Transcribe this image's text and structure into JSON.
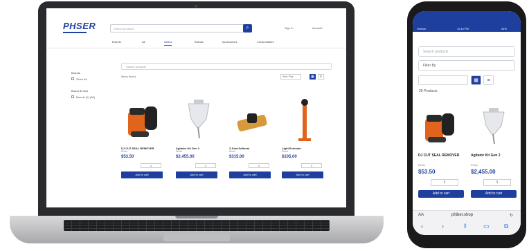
{
  "desktop": {
    "logo": "PHSER",
    "search_placeholder": "Search products",
    "search_icon": "search-icon",
    "user_links": [
      "Sign In",
      "Account"
    ],
    "nav": [
      "Brands",
      "All",
      "Ablers",
      "Brands",
      "Accessories",
      "Consumables"
    ],
    "active_nav": 2,
    "filter_groups": [
      {
        "title": "Brands",
        "options": [
          "Show All"
        ]
      },
      {
        "title": "Brand ID Sort",
        "options": [
          "Brands (1) (28)"
        ]
      }
    ],
    "product_search_placeholder": "Search products",
    "results_label": "Items found",
    "sort_label": "Sort / Pos",
    "view_icons": [
      "grid-icon",
      "list-icon"
    ],
    "products": [
      {
        "name": "DJ CUT SEAL REMOVER",
        "brand": "Ekoto",
        "price": "$53.50",
        "qty": "1",
        "add_label": "Add to cart"
      },
      {
        "name": "Agitator Kit Gen 2",
        "brand": "Ekoto",
        "price": "$2,455.00",
        "qty": "1",
        "add_label": "Add to cart"
      },
      {
        "name": "Z-Seat Softseat",
        "brand": "Ekoto",
        "price": "$315.00",
        "qty": "1",
        "add_label": "Add to cart"
      },
      {
        "name": "Light Extender",
        "brand": "Ekoto",
        "price": "$105.00",
        "qty": "1",
        "add_label": "Add to cart"
      }
    ]
  },
  "mobile": {
    "status": {
      "carrier": "Verizon",
      "time": "11:44 PM",
      "battery": "51%"
    },
    "search_placeholder": "Search products",
    "filter_label": "Filter By",
    "results_count": "28 Products",
    "products": [
      {
        "name": "DJ CUT SEAL REMOVER",
        "brand": "Ekoto",
        "price": "$53.50",
        "qty": "1",
        "add_label": "Add to cart"
      },
      {
        "name": "Agitator Kit Gen 2",
        "brand": "Ekoto",
        "price": "$2,455.00",
        "qty": "1",
        "add_label": "Add to cart"
      }
    ],
    "url_aa": "AA",
    "url": "phiber.shop",
    "reload_icon": "reload-icon",
    "toolbar": [
      "back-icon",
      "forward-icon",
      "share-icon",
      "bookmarks-icon",
      "tabs-icon"
    ]
  },
  "colors": {
    "brand": "#1f3f9e",
    "device": "#2a2b2e",
    "silver": "#c8c9cc"
  }
}
